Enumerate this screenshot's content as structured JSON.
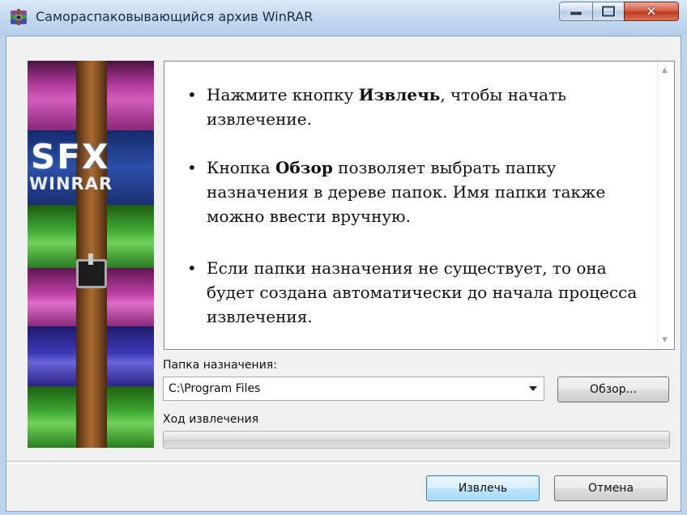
{
  "window": {
    "title": "Самораспаковывающийся архив WinRAR",
    "app_icon": "winrar-sfx-icon",
    "controls": [
      "minimize-icon",
      "maximize-icon",
      "close-icon"
    ]
  },
  "logo": {
    "line1": "SFX",
    "line2": "WINRAR"
  },
  "info": {
    "items": [
      {
        "before": "Нажмите кнопку ",
        "bold": "Извлечь",
        "after": ", чтобы начать извлечение."
      },
      {
        "before": "Кнопка ",
        "bold": "Обзор",
        "after": " позволяет выбрать папку назначения в дереве папок. Имя папки также можно ввести вручную."
      },
      {
        "before": "",
        "bold": "",
        "after": "Если папки назначения не существует, то она будет создана автоматически до начала процесса извлечения."
      }
    ]
  },
  "destination": {
    "label": "Папка назначения:",
    "value": "C:\\Program Files"
  },
  "browse_label": "Обзор...",
  "progress": {
    "label": "Ход извлечения",
    "fraction": 0
  },
  "buttons": {
    "extract": "Извлечь",
    "cancel": "Отмена"
  },
  "colors": {
    "title_bar": "#c2d8ef",
    "close_button": "#c0391f",
    "default_button_border": "#3c7fb1",
    "dialog_background": "#f0f0f0"
  }
}
